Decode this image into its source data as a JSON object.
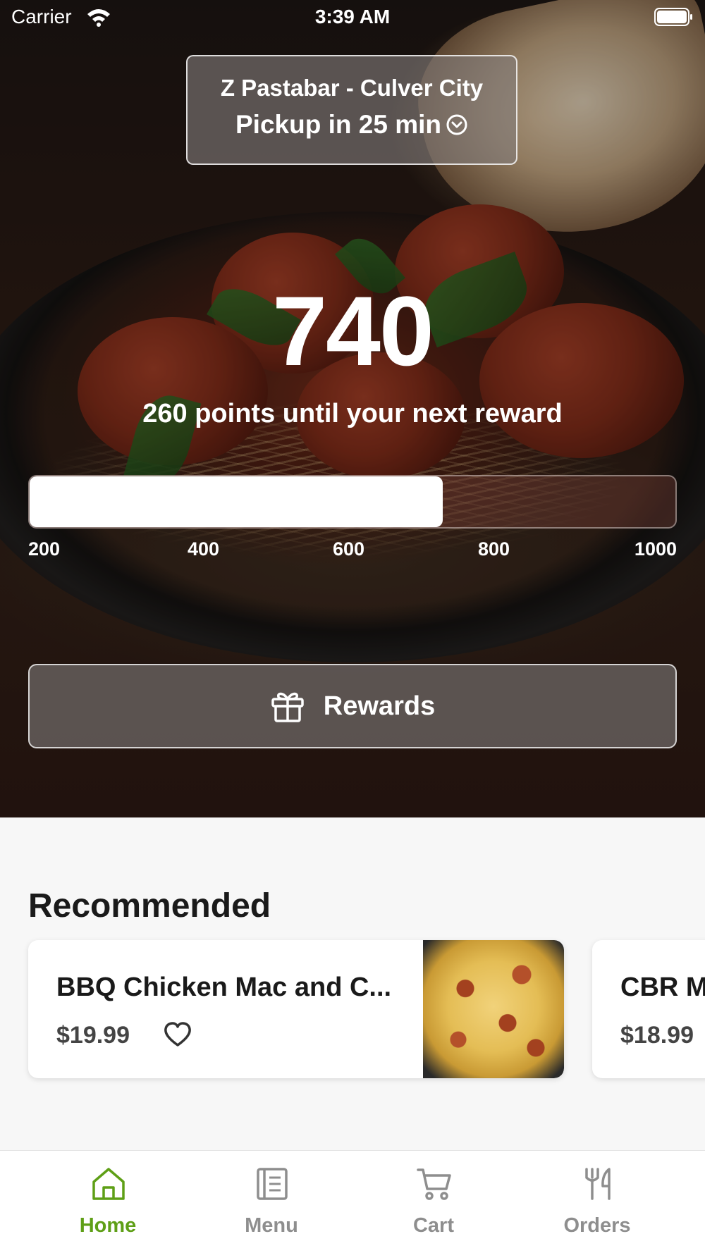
{
  "status_bar": {
    "carrier": "Carrier",
    "time": "3:39 AM"
  },
  "store": {
    "name": "Z Pastabar - Culver City",
    "pickup": "Pickup in 25 min"
  },
  "points": {
    "value": "740",
    "caption": "260 points until your next reward",
    "progress_fraction": 0.64,
    "ticks": [
      "200",
      "400",
      "600",
      "800",
      "1000"
    ]
  },
  "rewards_button": {
    "label": "Rewards"
  },
  "recommended": {
    "title": "Recommended",
    "items": [
      {
        "name": "BBQ Chicken Mac and C...",
        "price": "$19.99"
      },
      {
        "name": "CBR M",
        "price": "$18.99"
      }
    ]
  },
  "tab_bar": {
    "active_color": "#5e9f16",
    "inactive_color": "#8e8e8e",
    "tabs": [
      {
        "label": "Home",
        "icon": "home-icon",
        "active": true
      },
      {
        "label": "Menu",
        "icon": "menu-icon",
        "active": false
      },
      {
        "label": "Cart",
        "icon": "cart-icon",
        "active": false
      },
      {
        "label": "Orders",
        "icon": "utensils-icon",
        "active": false
      }
    ]
  }
}
